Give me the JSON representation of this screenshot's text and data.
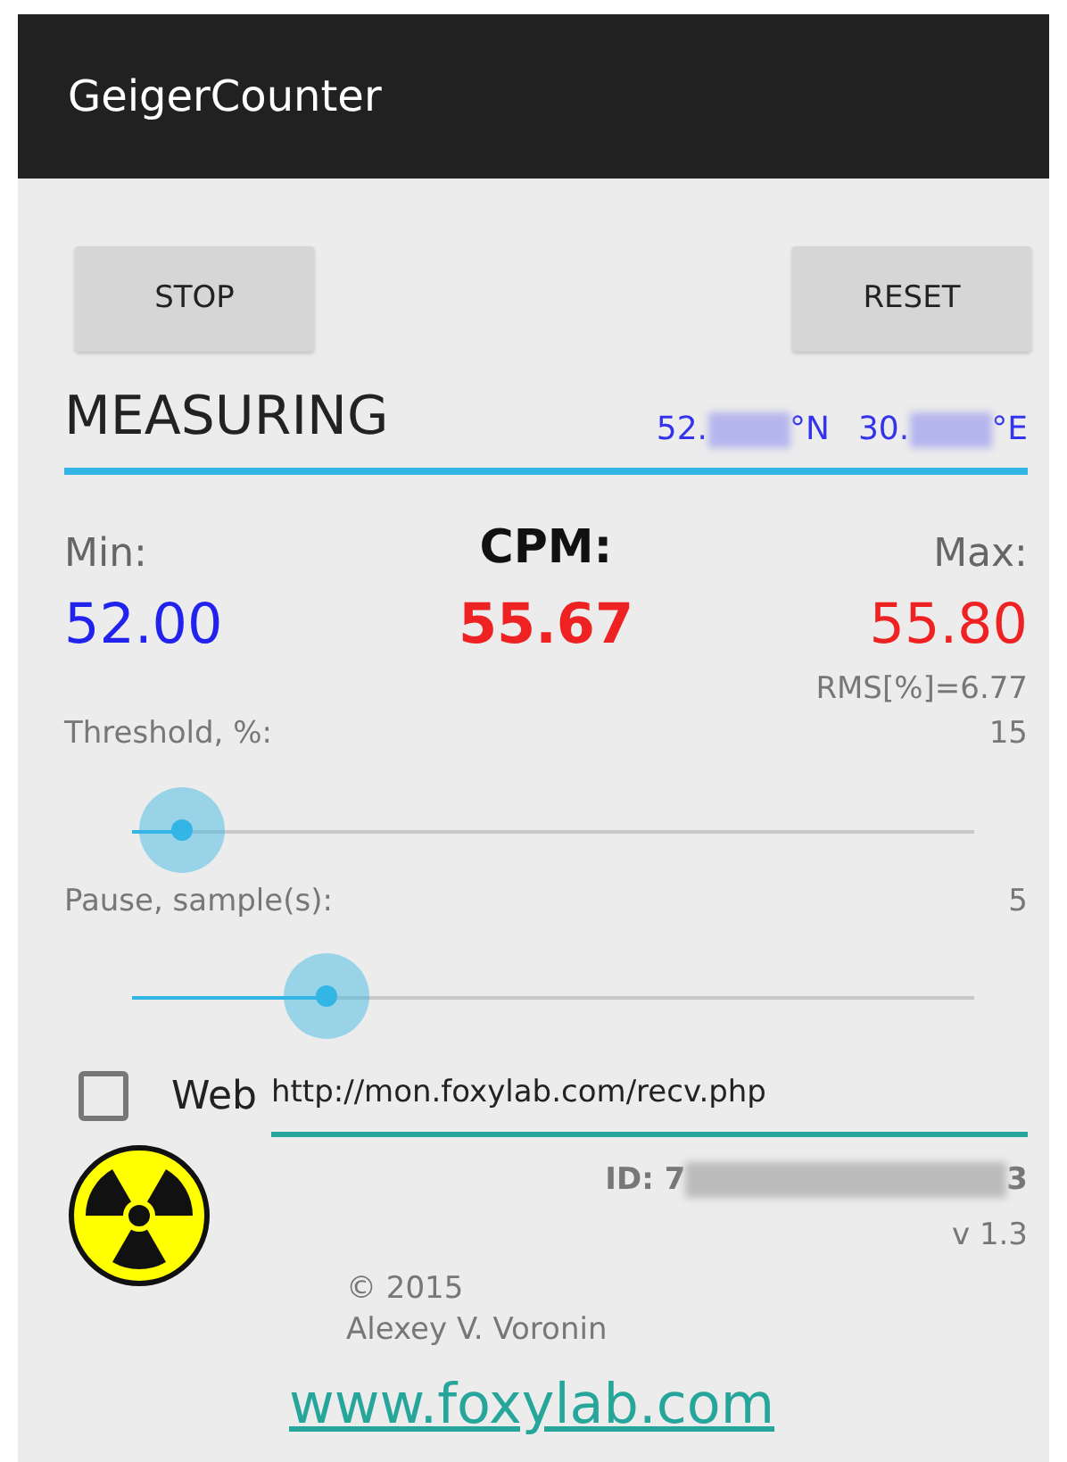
{
  "app_bar": {
    "title": "GeigerCounter"
  },
  "buttons": [
    {
      "label": "STOP"
    },
    {
      "label": "RESET"
    }
  ],
  "status": "MEASURING",
  "location": {
    "lat_prefix": "52.",
    "lat_suffix": "°N",
    "lon_prefix": "30.",
    "lon_suffix": "°E"
  },
  "stats": {
    "min_label": "Min:",
    "min_value": "52.00",
    "cpm_label": "CPM:",
    "cpm_value": "55.67",
    "max_label": "Max:",
    "max_value": "55.80",
    "rms": "RMS[%]=6.77"
  },
  "sliders": [
    {
      "label": "Threshold, %:",
      "reading": "15",
      "level": 0.06
    },
    {
      "label": "Pause, sample(s):",
      "reading": "5",
      "level": 0.23
    }
  ],
  "web": {
    "checked": false,
    "label": "Web",
    "url": "http://mon.foxylab.com/recv.php"
  },
  "device_id": {
    "prefix": "ID: 7",
    "suffix": "3"
  },
  "version": "v 1.3",
  "copyright": "© 2015",
  "author": "Alexey V. Voronin",
  "link": "www.foxylab.com"
}
